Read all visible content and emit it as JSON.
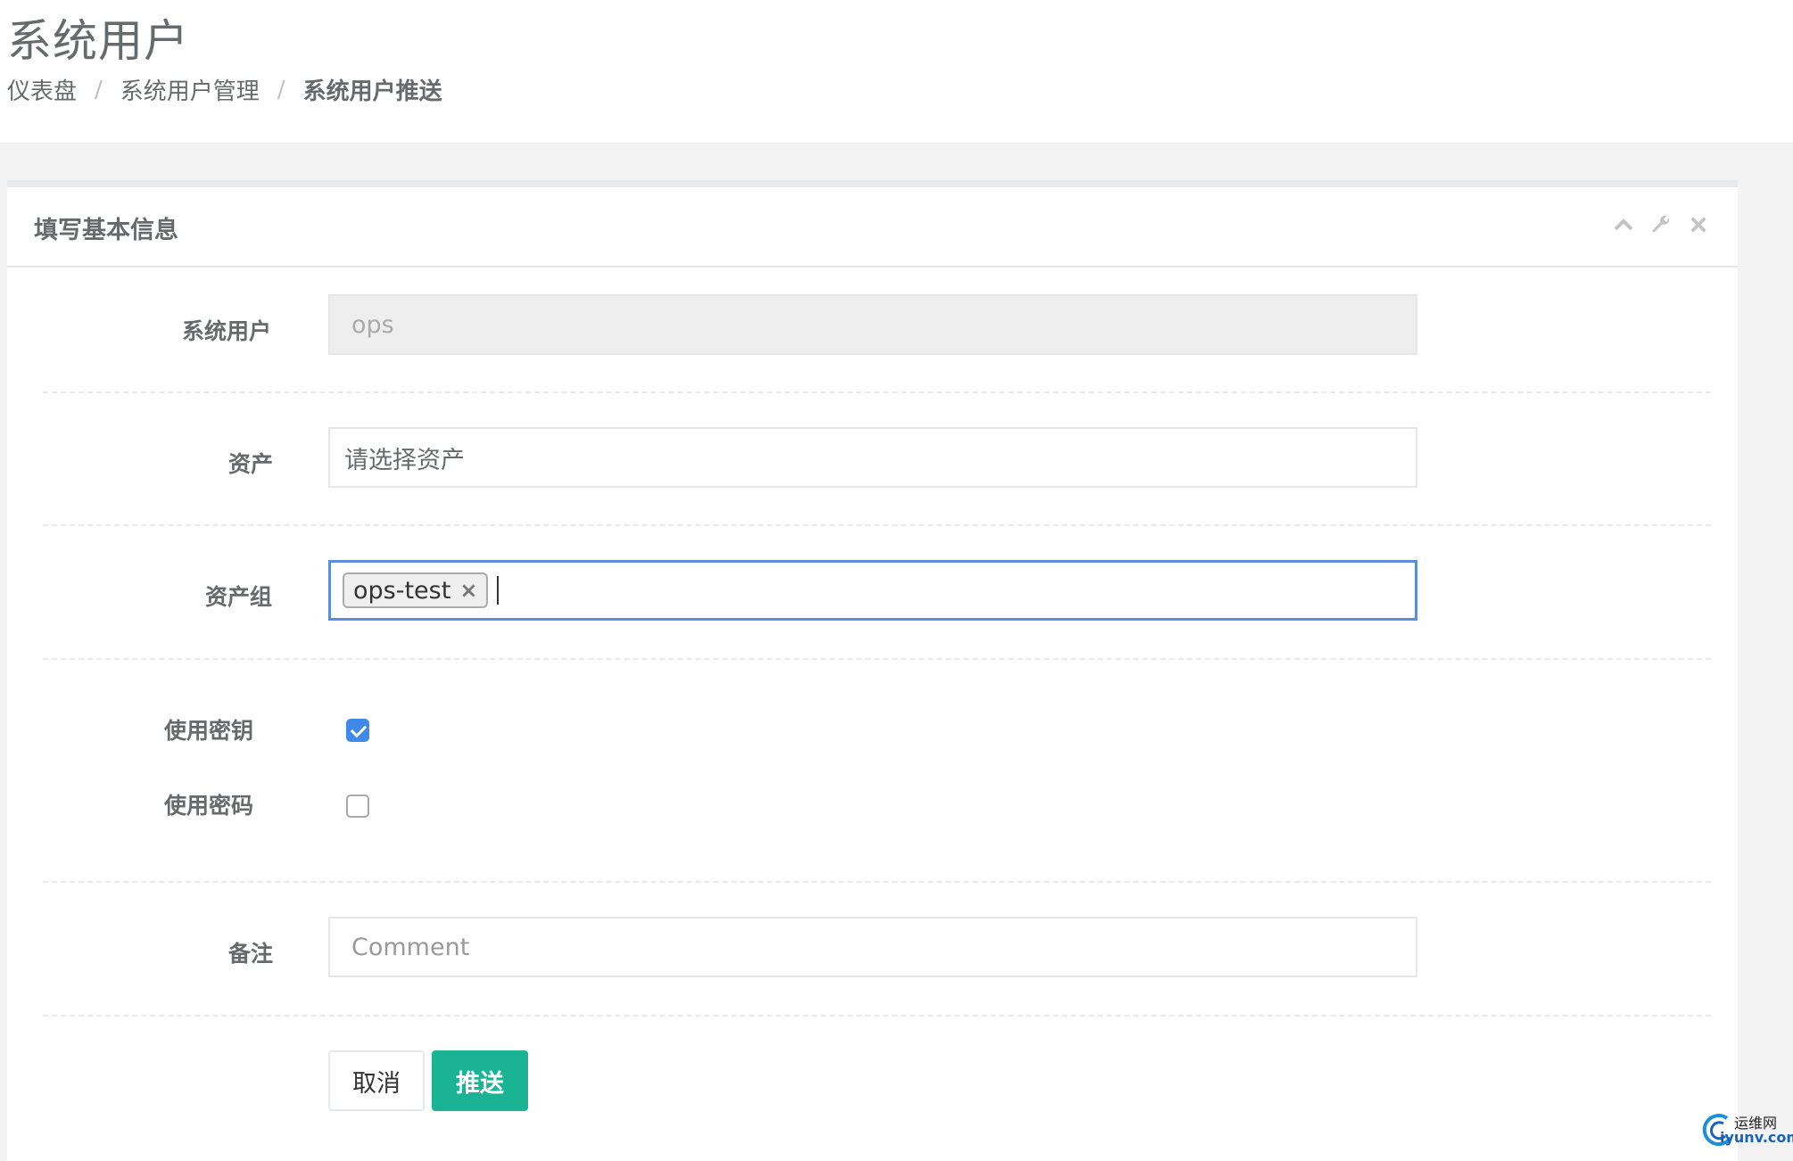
{
  "header": {
    "title": "系统用户",
    "breadcrumb": [
      "仪表盘",
      "系统用户管理",
      "系统用户推送"
    ],
    "separator": "/"
  },
  "panel": {
    "title": "填写基本信息",
    "tools": [
      "chevron-up-icon",
      "wrench-icon",
      "close-icon"
    ]
  },
  "form": {
    "system_user": {
      "label": "系统用户",
      "value": "ops"
    },
    "assets": {
      "label": "资产",
      "placeholder": "请选择资产"
    },
    "asset_group": {
      "label": "资产组",
      "tags": [
        {
          "text": "ops-test",
          "remove": "×"
        }
      ]
    },
    "use_key": {
      "label": "使用密钥",
      "checked": true
    },
    "use_password": {
      "label": "使用密码",
      "checked": false
    },
    "comment": {
      "label": "备注",
      "placeholder": "Comment"
    }
  },
  "actions": {
    "cancel": "取消",
    "submit": "推送"
  },
  "watermark": {
    "line1": "运维网",
    "line2": "iyunv.com"
  },
  "colors": {
    "primary": "#1ab394",
    "checkbox": "#3f8ae8",
    "focus_border": "#5b8dd9"
  }
}
